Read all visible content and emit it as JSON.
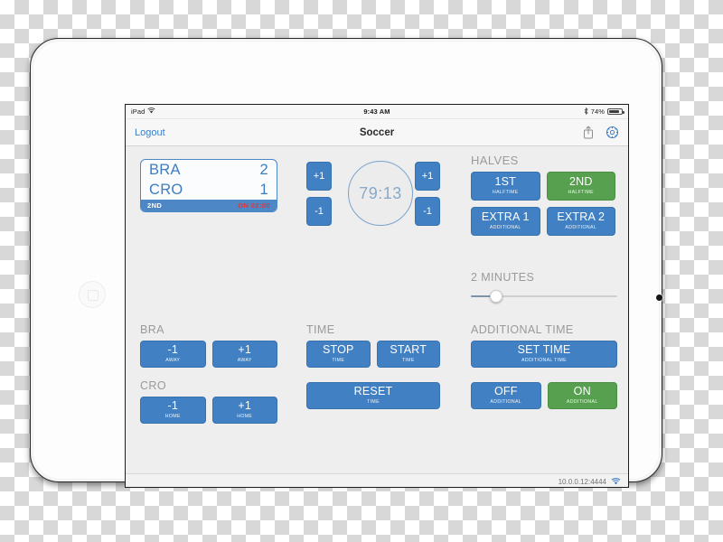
{
  "device": {
    "status_bar": {
      "carrier": "iPad",
      "wifi_icon": "wifi-icon",
      "time": "9:43 AM",
      "bluetooth_icon": "bluetooth-icon",
      "battery_percent": "74%",
      "battery_level": 74
    }
  },
  "nav": {
    "logout_label": "Logout",
    "title": "Soccer",
    "share_icon": "share-icon",
    "settings_icon": "gear-icon"
  },
  "scoreboard": {
    "rows": [
      {
        "team": "BRA",
        "score": "2"
      },
      {
        "team": "CRO",
        "score": "1"
      }
    ],
    "period": "2ND",
    "additional": "ON 02:00"
  },
  "timer": {
    "display": "79:13",
    "home_plus": "+1",
    "home_minus": "-1",
    "away_plus": "+1",
    "away_minus": "-1"
  },
  "halves": {
    "title": "HALVES",
    "buttons": [
      {
        "main": "1ST",
        "sub": "HALFTIME",
        "state": "inactive"
      },
      {
        "main": "2ND",
        "sub": "HALFTIME",
        "state": "active"
      },
      {
        "main": "EXTRA 1",
        "sub": "ADDITIONAL",
        "state": "inactive"
      },
      {
        "main": "EXTRA 2",
        "sub": "ADDITIONAL",
        "state": "inactive"
      }
    ]
  },
  "slider": {
    "label": "2 MINUTES",
    "value": 2,
    "percent": 17
  },
  "away_team": {
    "title": "BRA",
    "minus": {
      "main": "-1",
      "sub": "AWAY"
    },
    "plus": {
      "main": "+1",
      "sub": "AWAY"
    }
  },
  "home_team": {
    "title": "CRO",
    "minus": {
      "main": "-1",
      "sub": "HOME"
    },
    "plus": {
      "main": "+1",
      "sub": "HOME"
    }
  },
  "time_section": {
    "title": "TIME",
    "stop": {
      "main": "STOP",
      "sub": "TIME"
    },
    "start": {
      "main": "START",
      "sub": "TIME"
    },
    "reset": {
      "main": "RESET",
      "sub": "TIME"
    }
  },
  "additional_time": {
    "title": "ADDITIONAL TIME",
    "set_time": {
      "main": "SET TIME",
      "sub": "ADDITIONAL TIME"
    },
    "off": {
      "main": "OFF",
      "sub": "ADDITIONAL",
      "state": "inactive"
    },
    "on": {
      "main": "ON",
      "sub": "ADDITIONAL",
      "state": "active"
    }
  },
  "footer": {
    "address": "10.0.0.12:4444",
    "wifi_icon": "wifi-icon"
  },
  "colors": {
    "accent_blue": "#4180c2",
    "accent_green": "#57a04f",
    "scoreboard_border": "#4d87c6",
    "alert_red": "#d9373b",
    "screen_bg": "#eeeeee"
  }
}
